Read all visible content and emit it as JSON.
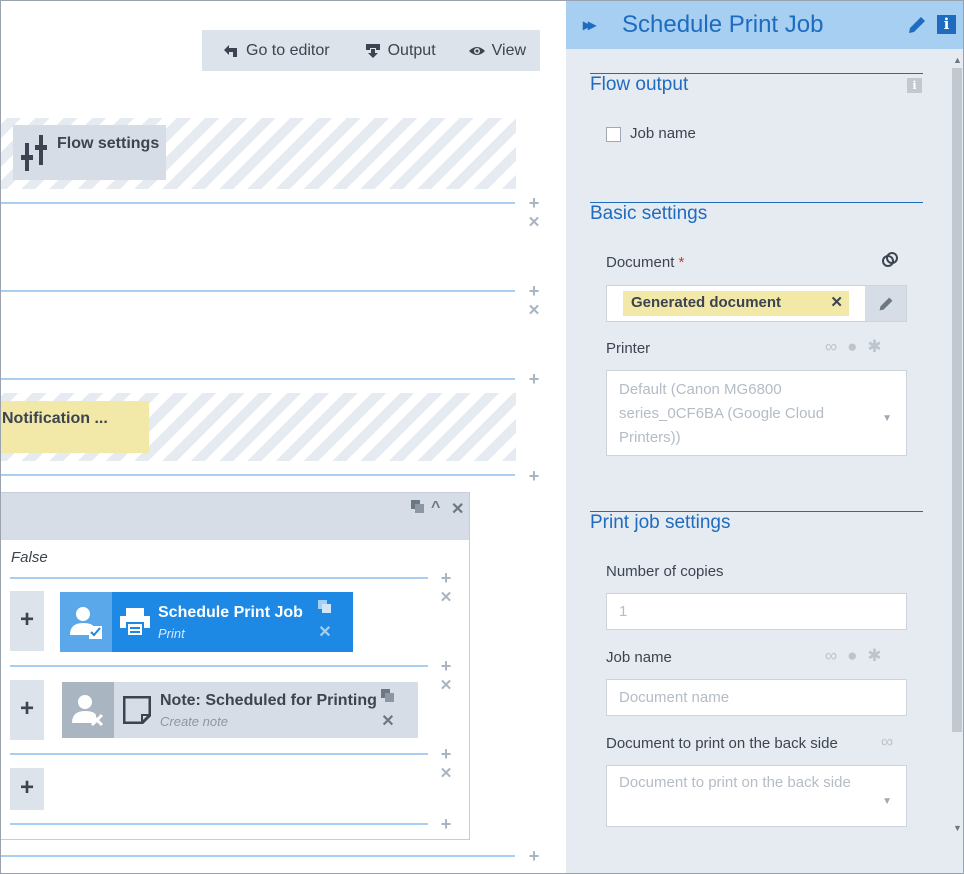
{
  "toolbar": {
    "go_to_editor": "Go to editor",
    "output": "Output",
    "view": "View"
  },
  "canvas": {
    "flow_settings": "Flow settings",
    "notification": "Notification ...",
    "branch_label": "False",
    "steps": [
      {
        "title": "Schedule Print Job",
        "subtitle": "Print"
      },
      {
        "title": "Note: Scheduled for Printing",
        "subtitle": "Create note"
      }
    ]
  },
  "panel": {
    "title": "Schedule Print Job",
    "sections": {
      "flow_output": "Flow output",
      "basic_settings": "Basic settings",
      "print_job_settings": "Print job settings"
    },
    "flow_output": {
      "job_name_label": "Job name"
    },
    "document": {
      "label": "Document",
      "required_mark": "*",
      "chip": "Generated document"
    },
    "printer": {
      "label": "Printer",
      "value": "Default (Canon MG6800 series_0CF6BA (Google Cloud Printers))"
    },
    "copies": {
      "label": "Number of copies",
      "placeholder": "1"
    },
    "job_name": {
      "label": "Job name",
      "placeholder": "Document name"
    },
    "back_side": {
      "label": "Document to print on the back side",
      "placeholder": "Document to print on the back side"
    }
  },
  "colors": {
    "accent": "#1e6bbf",
    "header_bg": "#a6cff2",
    "panel_bg": "#e6ebf1",
    "step_active": "#1e88e5",
    "chip_bg": "#f2e8a8"
  }
}
